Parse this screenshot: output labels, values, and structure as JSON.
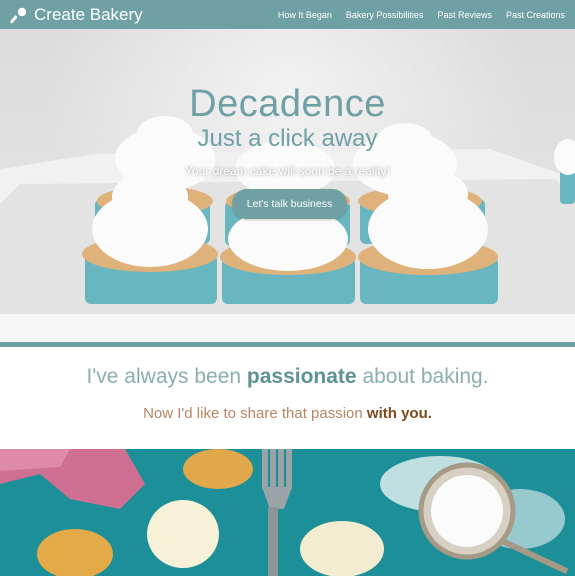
{
  "nav": {
    "brand": "Create Bakery",
    "links": [
      "How It Began",
      "Bakery Possibilities",
      "Past Reviews",
      "Past Creations"
    ]
  },
  "hero": {
    "title": "Decadence",
    "subtitle": "Just a click away",
    "tagline": "Your dream cake will soon be a reality!",
    "cta": "Let's talk business"
  },
  "passion": {
    "line1_pre": "I've always been ",
    "line1_bold": "passionate",
    "line1_post": " about baking.",
    "line2_pre": "Now I'd like to share that passion ",
    "line2_bold": "with you."
  },
  "colors": {
    "accent": "#6fa0a4",
    "brown": "#7b4a1e",
    "teal_bg": "#1d8f98"
  },
  "icons": {
    "brand": "whisk-icon"
  }
}
